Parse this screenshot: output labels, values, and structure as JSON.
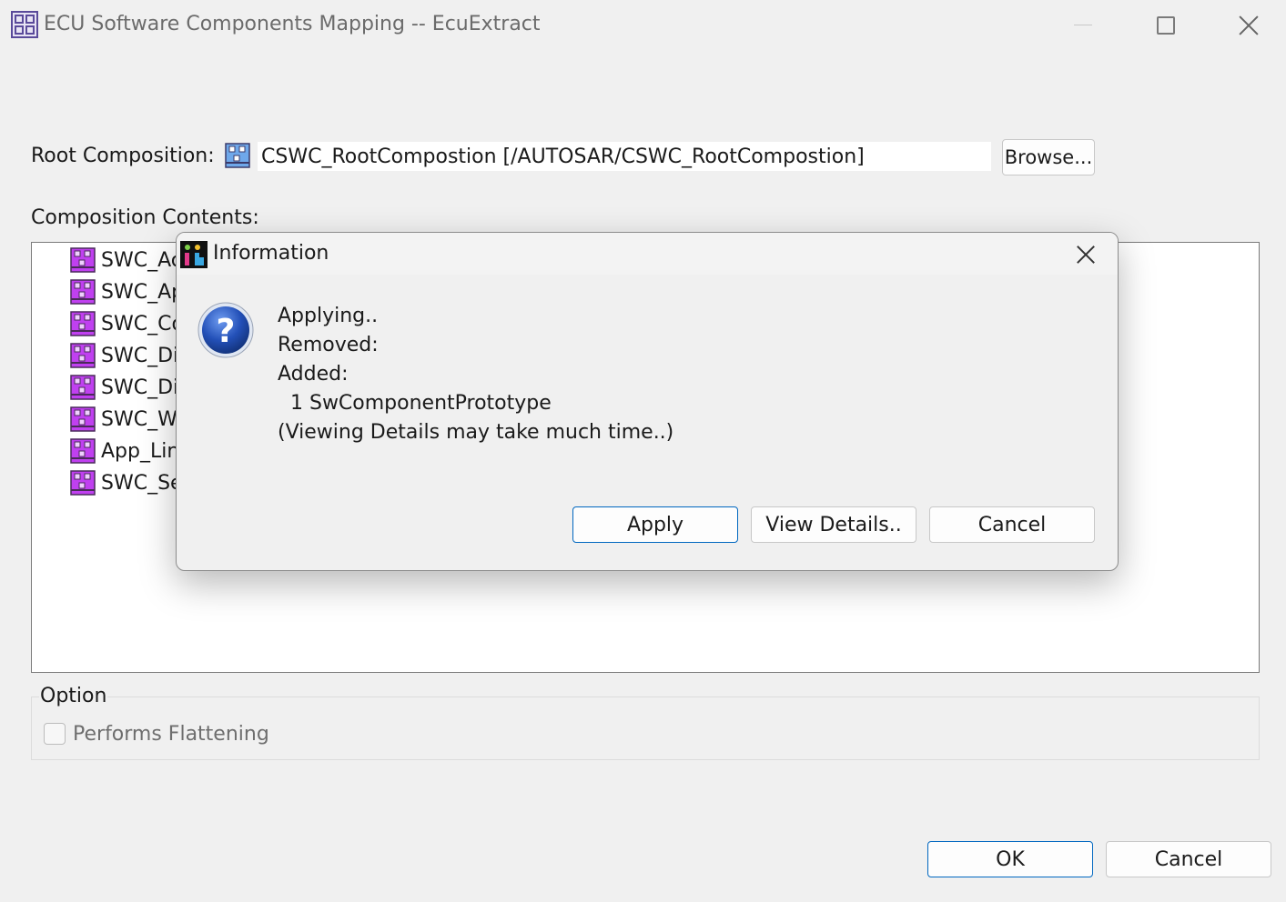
{
  "window": {
    "title": "ECU Software Components Mapping -- EcuExtract",
    "app_icon": "component-frame-icon",
    "controls": [
      "minimize-icon",
      "maximize-icon",
      "close-icon"
    ]
  },
  "root": {
    "label": "Root Composition:",
    "icon": "composition-icon",
    "value": "CSWC_RootCompostion [/AUTOSAR/CSWC_RootCompostion]",
    "browse_label": "Browse..."
  },
  "contents": {
    "label": "Composition Contents:",
    "items": [
      {
        "label": "SWC_Ac",
        "icon": "swc-icon"
      },
      {
        "label": "SWC_Ap",
        "icon": "swc-icon"
      },
      {
        "label": "SWC_Co",
        "icon": "swc-icon"
      },
      {
        "label": "SWC_Di",
        "icon": "swc-icon"
      },
      {
        "label": "SWC_Di",
        "icon": "swc-icon"
      },
      {
        "label": "SWC_W",
        "icon": "swc-icon"
      },
      {
        "label": "App_Lin",
        "icon": "swc-icon"
      },
      {
        "label": "SWC_Se",
        "icon": "swc-icon"
      }
    ]
  },
  "option": {
    "legend": "Option",
    "flatten_label": "Performs Flattening",
    "flatten_checked": false
  },
  "footer": {
    "ok_label": "OK",
    "cancel_label": "Cancel"
  },
  "dialog": {
    "title": "Information",
    "icon": "question-icon",
    "lines": [
      "Applying..",
      "Removed:",
      "Added:",
      "  1 SwComponentPrototype",
      "(Viewing Details may take much time..)"
    ],
    "apply_label": "Apply",
    "details_label": "View Details..",
    "cancel_label": "Cancel"
  },
  "colors": {
    "swc_icon": "#c040f0",
    "accent_border": "#0067c0",
    "question_blue": "#1e4fb8"
  }
}
